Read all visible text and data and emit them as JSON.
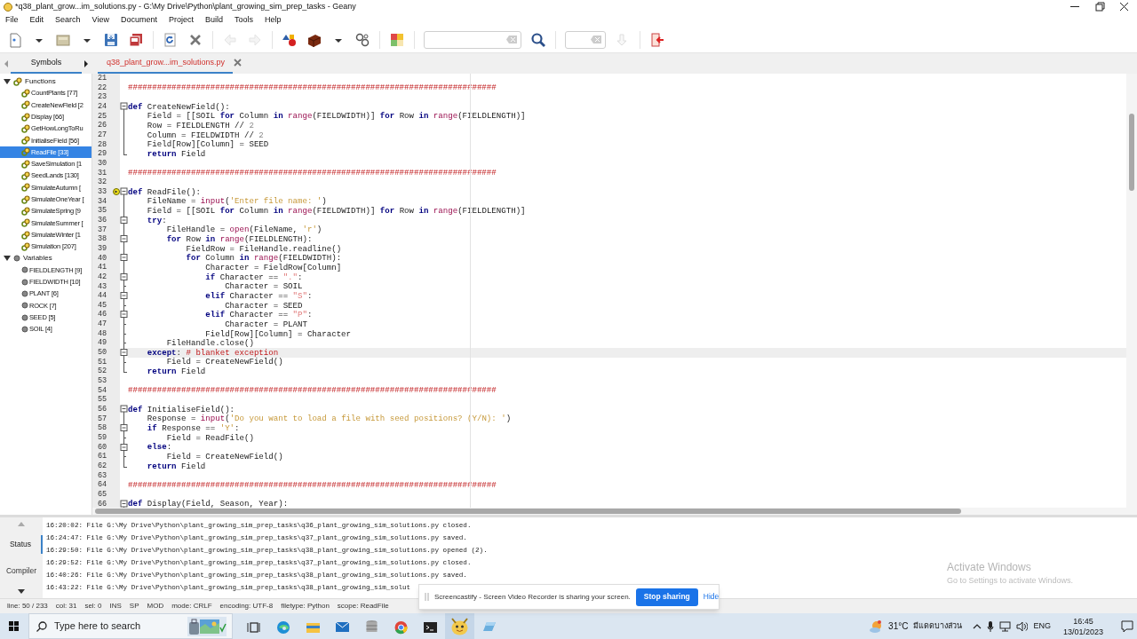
{
  "window": {
    "title": "*q38_plant_grow...im_solutions.py - G:\\My Drive\\Python\\plant_growing_sim_prep_tasks - Geany"
  },
  "menu": [
    "File",
    "Edit",
    "Search",
    "View",
    "Document",
    "Project",
    "Build",
    "Tools",
    "Help"
  ],
  "toolbar": [
    {
      "kind": "new",
      "disabled": false
    },
    {
      "kind": "dropdown",
      "disabled": false
    },
    {
      "kind": "open",
      "disabled": false
    },
    {
      "kind": "dropdown",
      "disabled": false
    },
    {
      "kind": "save",
      "disabled": false
    },
    {
      "kind": "save_all",
      "disabled": false
    },
    {
      "kind": "separator"
    },
    {
      "kind": "reload",
      "disabled": false
    },
    {
      "kind": "close",
      "disabled": false
    },
    {
      "kind": "separator"
    },
    {
      "kind": "back",
      "disabled": true
    },
    {
      "kind": "forward",
      "disabled": true
    },
    {
      "kind": "separator"
    },
    {
      "kind": "compile",
      "disabled": false
    },
    {
      "kind": "build",
      "disabled": false
    },
    {
      "kind": "dropdown",
      "disabled": false
    },
    {
      "kind": "execute",
      "disabled": false
    },
    {
      "kind": "separator"
    },
    {
      "kind": "color",
      "disabled": false
    },
    {
      "kind": "separator"
    },
    {
      "kind": "search_field"
    },
    {
      "kind": "search",
      "disabled": false
    },
    {
      "kind": "separator"
    },
    {
      "kind": "goto_field"
    },
    {
      "kind": "jump",
      "disabled": true
    },
    {
      "kind": "separator"
    },
    {
      "kind": "quit",
      "disabled": false
    }
  ],
  "sidebar": {
    "tabs": [
      {
        "label": "Symbols",
        "selected": true
      }
    ],
    "tree": [
      {
        "label": "Functions",
        "kind": "function",
        "expanded": true,
        "children": [
          {
            "label": "CountPlants [77]",
            "selected": false
          },
          {
            "label": "CreateNewField [2",
            "selected": false
          },
          {
            "label": "Display [66]",
            "selected": false
          },
          {
            "label": "GetHowLongToRu",
            "selected": false
          },
          {
            "label": "InitialiseField [56]",
            "selected": false
          },
          {
            "label": "ReadFile [33]",
            "selected": true
          },
          {
            "label": "SaveSimulation [1",
            "selected": false
          },
          {
            "label": "SeedLands [130]",
            "selected": false
          },
          {
            "label": "SimulateAutumn [",
            "selected": false
          },
          {
            "label": "SimulateOneYear [",
            "selected": false
          },
          {
            "label": "SimulateSpring [9",
            "selected": false
          },
          {
            "label": "SimulateSummer [",
            "selected": false
          },
          {
            "label": "SimulateWinter [1",
            "selected": false
          },
          {
            "label": "Simulation [207]",
            "selected": false
          }
        ]
      },
      {
        "label": "Variables",
        "kind": "variable",
        "expanded": true,
        "children": [
          {
            "label": "FIELDLENGTH [9]",
            "selected": false
          },
          {
            "label": "FIELDWIDTH [10]",
            "selected": false
          },
          {
            "label": "PLANT [6]",
            "selected": false
          },
          {
            "label": "ROCK [7]",
            "selected": false
          },
          {
            "label": "SEED [5]",
            "selected": false
          },
          {
            "label": "SOIL [4]",
            "selected": false
          }
        ]
      }
    ]
  },
  "document_tabs": [
    {
      "label": "q38_plant_grow...im_solutions.py",
      "modified": true,
      "selected": true
    }
  ],
  "editor": {
    "lines": [
      {
        "n": "21",
        "current": false
      },
      {
        "n": "22",
        "current": false,
        "segs": [
          {
            "kind": "comment",
            "text": "############################################################################"
          }
        ]
      },
      {
        "n": "23",
        "current": false
      },
      {
        "n": "24",
        "kind": "start",
        "current": false,
        "segs": [
          {
            "kind": "keyword",
            "text": "def"
          },
          {
            "kind": "plain",
            "text": " CreateNewField():"
          }
        ]
      },
      {
        "n": "25",
        "kind": "line",
        "current": false,
        "segs": [
          {
            "kind": "plain",
            "text": "    Field = [[SOIL "
          },
          {
            "kind": "keyword",
            "text": "for"
          },
          {
            "kind": "plain",
            "text": " Column "
          },
          {
            "kind": "keyword",
            "text": "in"
          },
          {
            "kind": "builtin",
            "text": " range"
          },
          {
            "kind": "plain",
            "text": "(FIELDWIDTH)] "
          },
          {
            "kind": "keyword",
            "text": "for"
          },
          {
            "kind": "plain",
            "text": " Row "
          },
          {
            "kind": "keyword",
            "text": "in"
          },
          {
            "kind": "builtin",
            "text": " range"
          },
          {
            "kind": "plain",
            "text": "(FIELDLENGTH)]"
          }
        ]
      },
      {
        "n": "26",
        "kind": "line",
        "current": false,
        "segs": [
          {
            "kind": "plain",
            "text": "    Row = FIELDLENGTH // "
          },
          {
            "kind": "number",
            "text": "2"
          }
        ]
      },
      {
        "n": "27",
        "kind": "line",
        "current": false,
        "segs": [
          {
            "kind": "plain",
            "text": "    Column = FIELDWIDTH // "
          },
          {
            "kind": "number",
            "text": "2"
          }
        ]
      },
      {
        "n": "28",
        "kind": "line",
        "current": false,
        "segs": [
          {
            "kind": "plain",
            "text": "    Field[Row][Column] = SEED"
          }
        ]
      },
      {
        "n": "29",
        "kind": "end",
        "current": false,
        "segs": [
          {
            "kind": "keyword",
            "text": "    return"
          },
          {
            "kind": "plain",
            "text": " Field"
          }
        ]
      },
      {
        "n": "30",
        "current": false
      },
      {
        "n": "31",
        "current": false,
        "segs": [
          {
            "kind": "comment",
            "text": "############################################################################"
          }
        ]
      },
      {
        "n": "32",
        "current": false
      },
      {
        "n": "33",
        "kind": "start",
        "marker": {
          "kind": "arrow"
        },
        "current": false,
        "segs": [
          {
            "kind": "keyword",
            "text": "def"
          },
          {
            "kind": "plain",
            "text": " ReadFile():"
          }
        ]
      },
      {
        "n": "34",
        "kind": "line",
        "current": false,
        "segs": [
          {
            "kind": "plain",
            "text": "    FileName = "
          },
          {
            "kind": "builtin",
            "text": "input"
          },
          {
            "kind": "plain",
            "text": "("
          },
          {
            "kind": "string",
            "text": "'Enter file name: '"
          },
          {
            "kind": "plain",
            "text": ")"
          }
        ]
      },
      {
        "n": "35",
        "kind": "line",
        "current": false,
        "segs": [
          {
            "kind": "plain",
            "text": "    Field = [[SOIL "
          },
          {
            "kind": "keyword",
            "text": "for"
          },
          {
            "kind": "plain",
            "text": " Column "
          },
          {
            "kind": "keyword",
            "text": "in"
          },
          {
            "kind": "builtin",
            "text": " range"
          },
          {
            "kind": "plain",
            "text": "(FIELDWIDTH)] "
          },
          {
            "kind": "keyword",
            "text": "for"
          },
          {
            "kind": "plain",
            "text": " Row "
          },
          {
            "kind": "keyword",
            "text": "in"
          },
          {
            "kind": "builtin",
            "text": " range"
          },
          {
            "kind": "plain",
            "text": "(FIELDLENGTH)]"
          }
        ]
      },
      {
        "n": "36",
        "kind": "inner",
        "current": false,
        "segs": [
          {
            "kind": "keyword",
            "text": "    try"
          },
          {
            "kind": "plain",
            "text": ":"
          }
        ]
      },
      {
        "n": "37",
        "kind": "line",
        "current": false,
        "segs": [
          {
            "kind": "plain",
            "text": "        FileHandle = "
          },
          {
            "kind": "builtin",
            "text": "open"
          },
          {
            "kind": "plain",
            "text": "(FileName, "
          },
          {
            "kind": "string",
            "text": "'r'"
          },
          {
            "kind": "plain",
            "text": ")"
          }
        ]
      },
      {
        "n": "38",
        "kind": "inner",
        "current": false,
        "segs": [
          {
            "kind": "keyword",
            "text": "        for"
          },
          {
            "kind": "plain",
            "text": " Row "
          },
          {
            "kind": "keyword",
            "text": "in"
          },
          {
            "kind": "builtin",
            "text": " range"
          },
          {
            "kind": "plain",
            "text": "(FIELDLENGTH):"
          }
        ]
      },
      {
        "n": "39",
        "kind": "line",
        "current": false,
        "segs": [
          {
            "kind": "plain",
            "text": "            FieldRow = FileHandle.readline()"
          }
        ]
      },
      {
        "n": "40",
        "kind": "inner",
        "current": false,
        "segs": [
          {
            "kind": "keyword",
            "text": "            for"
          },
          {
            "kind": "plain",
            "text": " Column "
          },
          {
            "kind": "keyword",
            "text": "in"
          },
          {
            "kind": "builtin",
            "text": " range"
          },
          {
            "kind": "plain",
            "text": "(FIELDWIDTH):"
          }
        ]
      },
      {
        "n": "41",
        "kind": "line",
        "current": false,
        "segs": [
          {
            "kind": "plain",
            "text": "                Character = FieldRow[Column]"
          }
        ]
      },
      {
        "n": "42",
        "kind": "inner",
        "current": false,
        "segs": [
          {
            "kind": "keyword",
            "text": "                if"
          },
          {
            "kind": "plain",
            "text": " Character == "
          },
          {
            "kind": "dstring",
            "text": "\".\""
          },
          {
            "kind": "plain",
            "text": ":"
          }
        ]
      },
      {
        "n": "43",
        "kind": "branch",
        "current": false,
        "segs": [
          {
            "kind": "plain",
            "text": "                    Character = SOIL"
          }
        ]
      },
      {
        "n": "44",
        "kind": "inner",
        "current": false,
        "segs": [
          {
            "kind": "keyword",
            "text": "                elif"
          },
          {
            "kind": "plain",
            "text": " Character == "
          },
          {
            "kind": "dstring",
            "text": "\"S\""
          },
          {
            "kind": "plain",
            "text": ":"
          }
        ]
      },
      {
        "n": "45",
        "kind": "branch",
        "current": false,
        "segs": [
          {
            "kind": "plain",
            "text": "                    Character = SEED"
          }
        ]
      },
      {
        "n": "46",
        "kind": "inner",
        "current": false,
        "segs": [
          {
            "kind": "keyword",
            "text": "                elif"
          },
          {
            "kind": "plain",
            "text": " Character == "
          },
          {
            "kind": "dstring",
            "text": "\"P\""
          },
          {
            "kind": "plain",
            "text": ":"
          }
        ]
      },
      {
        "n": "47",
        "kind": "branch",
        "current": false,
        "segs": [
          {
            "kind": "plain",
            "text": "                    Character = PLANT"
          }
        ]
      },
      {
        "n": "48",
        "kind": "branch",
        "current": false,
        "segs": [
          {
            "kind": "plain",
            "text": "                Field[Row][Column] = Character"
          }
        ]
      },
      {
        "n": "49",
        "kind": "branch",
        "current": false,
        "segs": [
          {
            "kind": "plain",
            "text": "        FileHandle.close()"
          }
        ]
      },
      {
        "n": "50",
        "kind": "inner",
        "current": true,
        "segs": [
          {
            "kind": "keyword",
            "text": "    except"
          },
          {
            "kind": "plain",
            "text": ": "
          },
          {
            "kind": "comment",
            "text": "# blanket exception"
          }
        ]
      },
      {
        "n": "51",
        "kind": "branch",
        "current": false,
        "segs": [
          {
            "kind": "plain",
            "text": "        Field = CreateNewField()"
          }
        ]
      },
      {
        "n": "52",
        "kind": "end",
        "current": false,
        "segs": [
          {
            "kind": "keyword",
            "text": "    return"
          },
          {
            "kind": "plain",
            "text": " Field"
          }
        ]
      },
      {
        "n": "53",
        "current": false
      },
      {
        "n": "54",
        "current": false,
        "segs": [
          {
            "kind": "comment",
            "text": "############################################################################"
          }
        ]
      },
      {
        "n": "55",
        "current": false
      },
      {
        "n": "56",
        "kind": "start",
        "current": false,
        "segs": [
          {
            "kind": "keyword",
            "text": "def"
          },
          {
            "kind": "plain",
            "text": " InitialiseField():"
          }
        ]
      },
      {
        "n": "57",
        "kind": "line",
        "current": false,
        "segs": [
          {
            "kind": "plain",
            "text": "    Response = "
          },
          {
            "kind": "builtin",
            "text": "input"
          },
          {
            "kind": "plain",
            "text": "("
          },
          {
            "kind": "string",
            "text": "'Do you want to load a file with seed positions? (Y/N): '"
          },
          {
            "kind": "plain",
            "text": ")"
          }
        ]
      },
      {
        "n": "58",
        "kind": "inner",
        "current": false,
        "segs": [
          {
            "kind": "keyword",
            "text": "    if"
          },
          {
            "kind": "plain",
            "text": " Response == "
          },
          {
            "kind": "string",
            "text": "'Y'"
          },
          {
            "kind": "plain",
            "text": ":"
          }
        ]
      },
      {
        "n": "59",
        "kind": "branch",
        "current": false,
        "segs": [
          {
            "kind": "plain",
            "text": "        Field = ReadFile()"
          }
        ]
      },
      {
        "n": "60",
        "kind": "inner",
        "current": false,
        "segs": [
          {
            "kind": "keyword",
            "text": "    else"
          },
          {
            "kind": "plain",
            "text": ":"
          }
        ]
      },
      {
        "n": "61",
        "kind": "branch",
        "current": false,
        "segs": [
          {
            "kind": "plain",
            "text": "        Field = CreateNewField()"
          }
        ]
      },
      {
        "n": "62",
        "kind": "end",
        "current": false,
        "segs": [
          {
            "kind": "keyword",
            "text": "    return"
          },
          {
            "kind": "plain",
            "text": " Field"
          }
        ]
      },
      {
        "n": "63",
        "current": false
      },
      {
        "n": "64",
        "current": false,
        "segs": [
          {
            "kind": "comment",
            "text": "############################################################################"
          }
        ]
      },
      {
        "n": "65",
        "current": false
      },
      {
        "n": "66",
        "kind": "start",
        "current": false,
        "segs": [
          {
            "kind": "keyword",
            "text": "def"
          },
          {
            "kind": "plain",
            "text": " Display(Field, Season, Year):"
          }
        ]
      }
    ]
  },
  "messages": {
    "tabs": [
      {
        "label": "Status",
        "selected": true
      },
      {
        "label": "Compiler",
        "selected": false
      }
    ],
    "lines": [
      "16:20:02: File G:\\My Drive\\Python\\plant_growing_sim_prep_tasks\\q36_plant_growing_sim_solutions.py closed.",
      "16:24:47: File G:\\My Drive\\Python\\plant_growing_sim_prep_tasks\\q37_plant_growing_sim_solutions.py saved.",
      "16:29:50: File G:\\My Drive\\Python\\plant_growing_sim_prep_tasks\\q38_plant_growing_sim_solutions.py opened (2).",
      "16:29:52: File G:\\My Drive\\Python\\plant_growing_sim_prep_tasks\\q37_plant_growing_sim_solutions.py closed.",
      "16:40:26: File G:\\My Drive\\Python\\plant_growing_sim_prep_tasks\\q38_plant_growing_sim_solutions.py saved.",
      "16:43:22: File G:\\My Drive\\Python\\plant_growing_sim_prep_tasks\\q38_plant_growing_sim_solut"
    ]
  },
  "status_bar": [
    "line: 50 / 233",
    "col: 31",
    "sel: 0",
    "INS",
    "SP",
    "MOD",
    "mode: CRLF",
    "encoding: UTF-8",
    "filetype: Python",
    "scope: ReadFile"
  ],
  "notification": {
    "text": "Screencastify - Screen Video Recorder is sharing your screen.",
    "button": "Stop sharing",
    "link": "Hide"
  },
  "activation": {
    "title": "Activate Windows",
    "text": "Go to Settings to activate Windows."
  },
  "taskbar": {
    "search_placeholder": "Type here to search",
    "apps": [
      {
        "kind": "taskview",
        "active": false
      },
      {
        "kind": "edge",
        "active": false
      },
      {
        "kind": "explorer",
        "active": false
      },
      {
        "kind": "mail",
        "active": false
      },
      {
        "kind": "database",
        "active": false
      },
      {
        "kind": "chrome",
        "active": false
      },
      {
        "kind": "terminal",
        "active": false
      },
      {
        "kind": "geany",
        "active": true
      },
      {
        "kind": "app",
        "active": false
      }
    ],
    "weather": {
      "temperature": "31°C",
      "condition": "มีแดดบางส่วน"
    },
    "language": "ENG",
    "time": "16:45",
    "date": "13/01/2023"
  }
}
